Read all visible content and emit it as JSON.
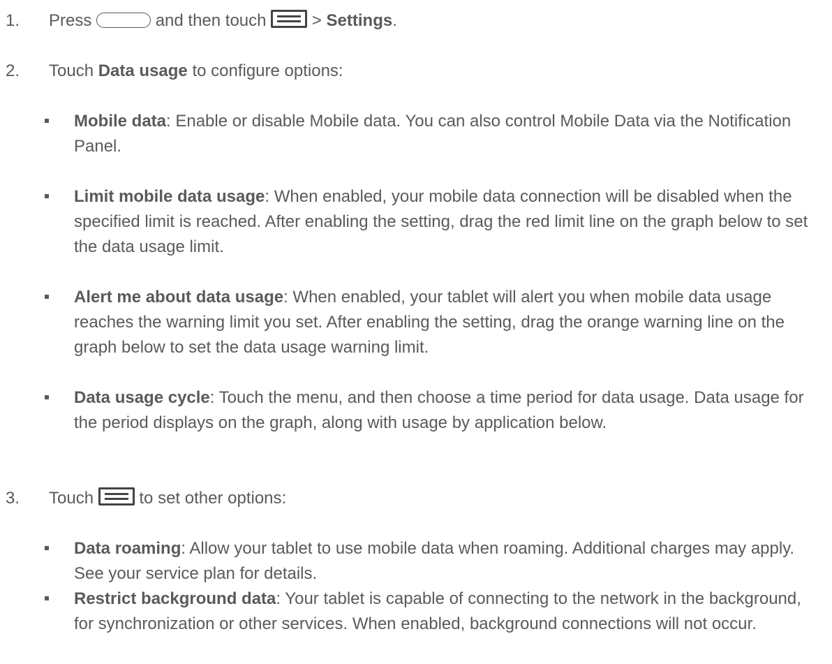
{
  "steps": [
    {
      "number": "1.",
      "press": "Press",
      "and_then_touch": "and then touch",
      "gt": ">",
      "settings": "Settings",
      "period": "."
    },
    {
      "number": "2.",
      "touch": "Touch",
      "data_usage": "Data usage",
      "rest": "to configure options:",
      "bullets": [
        {
          "title": "Mobile data",
          "text": ": Enable or disable Mobile data. You can also control Mobile Data via the Notification Panel."
        },
        {
          "title": "Limit mobile data usage",
          "text": ": When enabled, your mobile data connection will be disabled when the specified limit is reached. After enabling the setting, drag the red limit line on the graph below to set the data usage limit."
        },
        {
          "title": "Alert me about data usage",
          "text": ": When enabled, your tablet will alert you when mobile data usage reaches the warning limit you set. After enabling the setting, drag the orange warning line on the graph below to set the data usage warning limit."
        },
        {
          "title": "Data usage cycle",
          "text": ": Touch the menu, and then choose a time period for data usage. Data usage for the period displays on the graph, along with usage by application below."
        }
      ]
    },
    {
      "number": "3.",
      "touch": "Touch",
      "rest": "to set other options:",
      "bullets": [
        {
          "title": "Data roaming",
          "text": ": Allow your tablet to use mobile data when roaming. Additional charges may apply. See your service plan for details."
        },
        {
          "title": "Restrict background data",
          "text": ": Your tablet is capable of connecting to the network in the background, for synchronization or other services. When enabled, background connections will not occur."
        }
      ]
    }
  ],
  "icons": {
    "home_button": "home-button-icon",
    "menu_button": "menu-icon"
  }
}
